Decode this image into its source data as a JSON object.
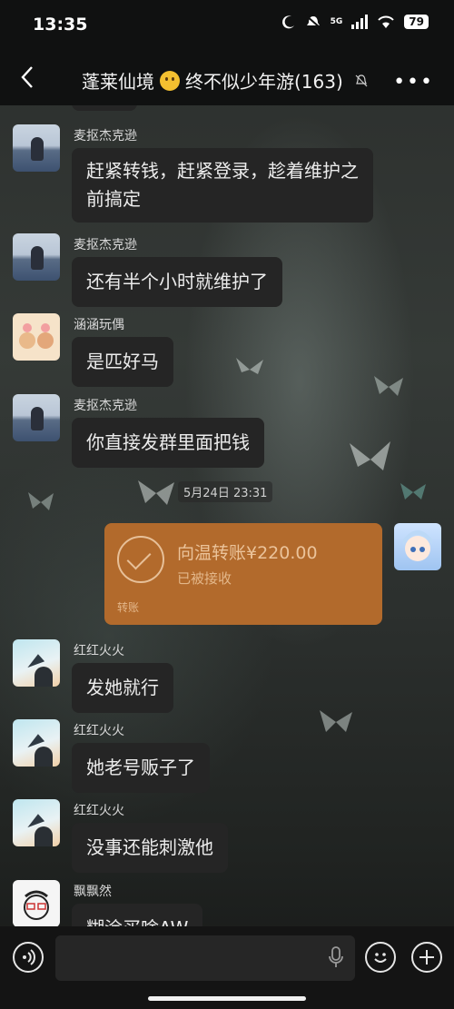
{
  "status_bar": {
    "time": "13:35",
    "network": "5G",
    "battery": "79"
  },
  "header": {
    "title_prefix": "蓬莱仙境",
    "title_suffix": "终不似少年游(163)",
    "back_icon": "chevron-left-icon",
    "mute_icon": "bell-off-icon",
    "more_icon": "more-dots-icon"
  },
  "messages": [
    {
      "nick": "麦抠杰克逊",
      "text_line1": "赶紧转钱，赶紧登录，趁着维护之",
      "text_line2": "前搞定"
    },
    {
      "nick": "麦抠杰克逊",
      "text": "还有半个小时就维护了"
    },
    {
      "nick": "涵涵玩偶",
      "text": "是匹好马"
    },
    {
      "nick": "麦抠杰克逊",
      "text": "你直接发群里面把钱"
    },
    {
      "nick": "红红火火",
      "text": "发她就行"
    },
    {
      "nick": "红红火火",
      "text": "她老号贩子了"
    },
    {
      "nick": "红红火火",
      "text": "没事还能刺激他"
    },
    {
      "nick": "飘飘然",
      "text": "糊涂买啥AW"
    }
  ],
  "timestamp": "5月24日 23:31",
  "transfer": {
    "amount_text": "向温转账¥220.00",
    "status": "已被接收",
    "label": "转账",
    "color": "#b26a2c"
  },
  "input_bar": {
    "voice_icon": "voice-icon",
    "mic_icon": "microphone-icon",
    "emoji_icon": "emoji-icon",
    "plus_icon": "plus-icon"
  }
}
